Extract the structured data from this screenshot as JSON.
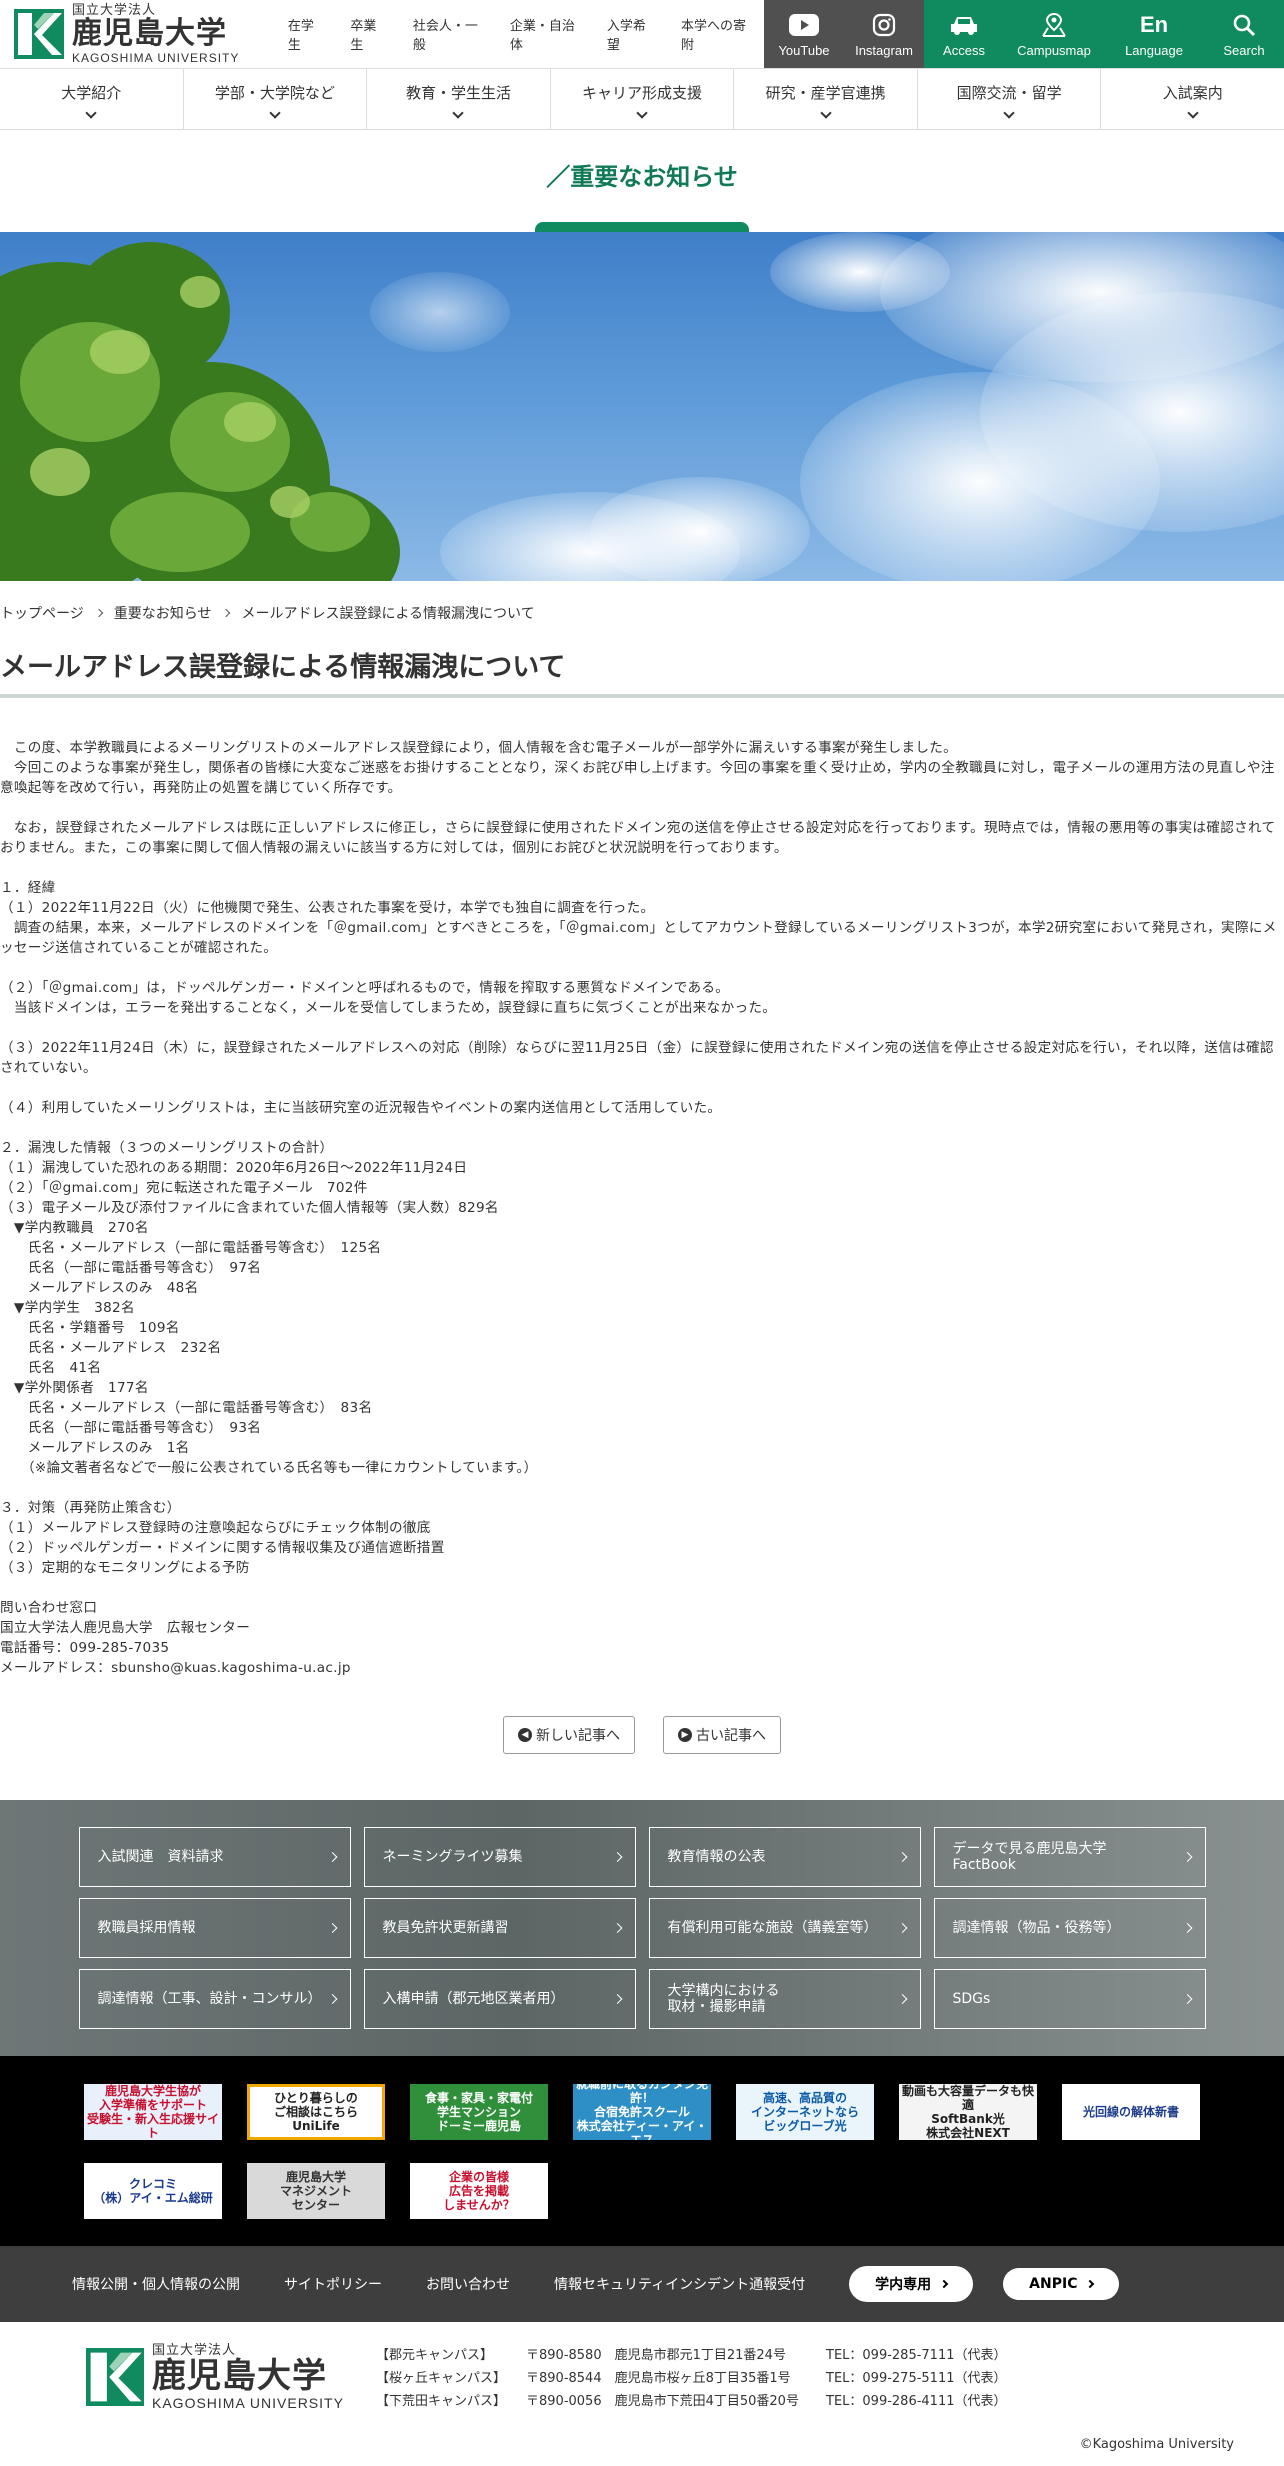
{
  "header": {
    "logo_small": "国立大学法人",
    "logo_big": "鹿児島大学",
    "logo_en": "KAGOSHIMA UNIVERSITY",
    "top_links": [
      "在学生",
      "卒業生",
      "社会人・一般",
      "企業・自治体",
      "入学希望",
      "本学への寄附"
    ],
    "icon_buttons": [
      {
        "label": "YouTube",
        "icon": "youtube-icon"
      },
      {
        "label": "Instagram",
        "icon": "instagram-icon"
      },
      {
        "label": "Access",
        "icon": "car-icon"
      },
      {
        "label": "Campusmap",
        "icon": "map-icon"
      },
      {
        "label": "Language",
        "icon": "language-icon",
        "glyph": "En"
      },
      {
        "label": "Search",
        "icon": "search-icon"
      }
    ]
  },
  "gnav": [
    "大学紹介",
    "学部・大学院など",
    "教育・学生生活",
    "キャリア形成支援",
    "研究・産学官連携",
    "国際交流・留学",
    "入試案内"
  ],
  "page_title": "重要なお知らせ",
  "breadcrumb": [
    "トップページ",
    "重要なお知らせ",
    "メールアドレス誤登録による情報漏洩について"
  ],
  "article": {
    "title": "メールアドレス誤登録による情報漏洩について",
    "lines": [
      "　この度、本学教職員によるメーリングリストのメールアドレス誤登録により，個人情報を含む電子メールが一部学外に漏えいする事案が発生しました。",
      "　今回このような事案が発生し，関係者の皆様に大変なご迷惑をお掛けすることとなり，深くお詫び申し上げます。今回の事案を重く受け止め，学内の全教職員に対し，電子メールの運用方法の見直しや注意喚起等を改めて行い，再発防止の処置を講じていく所存です。",
      "",
      "　なお，誤登録されたメールアドレスは既に正しいアドレスに修正し，さらに誤登録に使用されたドメイン宛の送信を停止させる設定対応を行っております。現時点では，情報の悪用等の事実は確認されておりません。また，この事案に関して個人情報の漏えいに該当する方に対しては，個別にお詫びと状況説明を行っております。",
      "",
      "１．経緯",
      "（１）2022年11月22日（火）に他機関で発生、公表された事案を受け，本学でも独自に調査を行った。",
      "　調査の結果，本来，メールアドレスのドメインを「＠gmail.com」とすべきところを，「＠gmai.com」としてアカウント登録しているメーリングリスト3つが，本学2研究室において発見され，実際にメッセージ送信されていることが確認された。",
      "",
      "（２）「＠gmai.com」は，ドッペルゲンガー・ドメインと呼ばれるもので，情報を搾取する悪質なドメインである。",
      "　当該ドメインは，エラーを発出することなく，メールを受信してしまうため，誤登録に直ちに気づくことが出来なかった。",
      "",
      "（３）2022年11月24日（木）に，誤登録されたメールアドレスへの対応（削除）ならびに翌11月25日（金）に誤登録に使用されたドメイン宛の送信を停止させる設定対応を行い，それ以降，送信は確認されていない。",
      "",
      "（４）利用していたメーリングリストは，主に当該研究室の近況報告やイベントの案内送信用として活用していた。",
      "",
      "２．漏洩した情報（３つのメーリングリストの合計）",
      "（１）漏洩していた恐れのある期間：2020年6月26日～2022年11月24日",
      "（２）「＠gmai.com」宛に転送された電子メール　702件",
      "（３）電子メール及び添付ファイルに含まれていた個人情報等（実人数）829名",
      "　▼学内教職員　270名",
      "　　氏名・メールアドレス（一部に電話番号等含む）　125名",
      "　　氏名（一部に電話番号等含む）　97名",
      "　　メールアドレスのみ　48名",
      "　▼学内学生　382名",
      "　　氏名・学籍番号　109名",
      "　　氏名・メールアドレス　232名",
      "　　氏名　41名",
      "　▼学外関係者　177名",
      "　　氏名・メールアドレス（一部に電話番号等含む）　83名",
      "　　氏名（一部に電話番号等含む）　93名",
      "　　メールアドレスのみ　1名",
      "　　（※論文著者名などで一般に公表されている氏名等も一律にカウントしています。）",
      "",
      "３．対策（再発防止策含む）",
      "（１）メールアドレス登録時の注意喚起ならびにチェック体制の徹底",
      "（２）ドッペルゲンガー・ドメインに関する情報収集及び通信遮断措置",
      "（３）定期的なモニタリングによる予防",
      "",
      "問い合わせ窓口",
      "国立大学法人鹿児島大学　広報センター",
      "電話番号：099-285-7035",
      "メールアドレス：sbunsho@kuas.kagoshima-u.ac.jp"
    ]
  },
  "pager": {
    "newer": "新しい記事へ",
    "older": "古い記事へ"
  },
  "link_grid": [
    "入試関連　資料請求",
    "ネーミングライツ募集",
    "教育情報の公表",
    "データで見る鹿児島大学\nFactBook",
    "教職員採用情報",
    "教員免許状更新講習",
    "有償利用可能な施設（講義室等）",
    "調達情報（物品・役務等）",
    "調達情報（工事、設計・コンサル）",
    "入構申請（郡元地区業者用）",
    "大学構内における\n取材・撮影申請",
    "SDGs"
  ],
  "banners": [
    {
      "text": "鹿児島大学生協が\n入学準備をサポート\n受験生・新入生応援サイト",
      "bg": "#e8f0fb",
      "fg": "#c8102e"
    },
    {
      "text": "ひとり暮らしの\nご相談はこちら\nUniLife",
      "bg": "#ffffff",
      "fg": "#222222",
      "border": "#f0a800"
    },
    {
      "text": "食事・家具・家電付\n学生マンション\nドーミー鹿児島",
      "bg": "#2f8f3a",
      "fg": "#ffffff"
    },
    {
      "text": "就職前に取るカンタン免許！\n合宿免許スクール\n株式会社ティー・アイ・エス",
      "bg": "#2d8fc6",
      "fg": "#ffffff"
    },
    {
      "text": "高速、高品質の\nインターネットなら\nビッグローブ光",
      "bg": "#eaf4fb",
      "fg": "#0b5aa8"
    },
    {
      "text": "動画も大容量データも快適\nSoftBank光\n株式会社NEXT",
      "bg": "#f4f4f4",
      "fg": "#222222"
    },
    {
      "text": "光回線の解体新書",
      "bg": "#ffffff",
      "fg": "#1f3d8a"
    },
    {
      "text": "クレコミ\n（株）アイ・エム総研",
      "bg": "#ffffff",
      "fg": "#1a3a8f"
    },
    {
      "text": "鹿児島大学\nマネジメント\nセンター",
      "bg": "#d9d9d9",
      "fg": "#333333"
    },
    {
      "text": "企業の皆様\n広告を掲載\nしませんか？",
      "bg": "#ffffff",
      "fg": "#c8102e"
    }
  ],
  "footer_links": [
    "情報公開・個人情報の公開",
    "サイトポリシー",
    "お問い合わせ",
    "情報セキュリティインシデント通報受付"
  ],
  "footer_pills": [
    "学内専用",
    "ANPIC"
  ],
  "footer": {
    "logo_small": "国立大学法人",
    "logo_big": "鹿児島大学",
    "logo_en": "KAGOSHIMA UNIVERSITY",
    "campuses": [
      {
        "name": "【郡元キャンパス】",
        "addr": "〒890-8580　鹿児島市郡元1丁目21番24号",
        "tel": "TEL：099-285-7111（代表）"
      },
      {
        "name": "【桜ヶ丘キャンパス】",
        "addr": "〒890-8544　鹿児島市桜ヶ丘8丁目35番1号",
        "tel": "TEL：099-275-5111（代表）"
      },
      {
        "name": "【下荒田キャンパス】",
        "addr": "〒890-0056　鹿児島市下荒田4丁目50番20号",
        "tel": "TEL：099-286-4111（代表）"
      }
    ],
    "copyright": "©Kagoshima University"
  },
  "colors": {
    "brand_green": "#0f8b5f",
    "dark_gray": "#505050"
  }
}
